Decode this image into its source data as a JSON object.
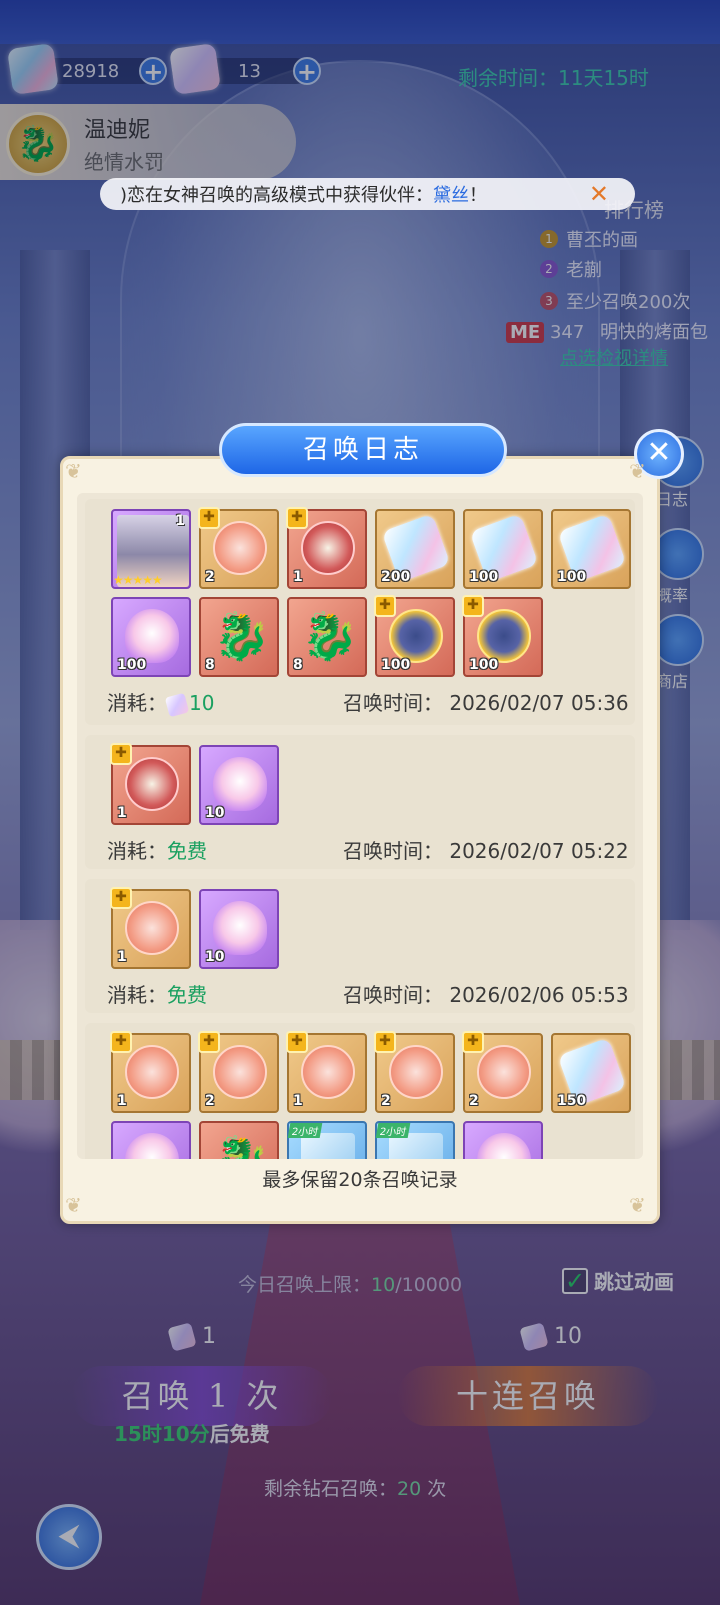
{
  "currency": {
    "diamonds": "28918",
    "tickets": "13",
    "time_left": "剩余时间：11天15时"
  },
  "character": {
    "name": "温迪妮",
    "subtitle": "绝情水罚"
  },
  "marquee": {
    "prefix": ")恋在女神召唤的高级模式中获得伙伴：",
    "partner": "黛丝",
    "suffix": "！"
  },
  "ranking": {
    "title": "排行榜",
    "entries": [
      {
        "rank": "1",
        "name": "曹丕的画"
      },
      {
        "rank": "2",
        "name": "老蒯"
      },
      {
        "rank": "3",
        "name": "至少召唤200次"
      }
    ],
    "me_label": "ME",
    "me_rank": "347",
    "me_name": "明快的烤面包",
    "detail_link": "点选检视详情"
  },
  "side_buttons": {
    "log": "日志",
    "rate": "概率",
    "shop": "商店"
  },
  "modal": {
    "title": "召唤日志",
    "footer": "最多保留20条召唤记录",
    "cost_label": "消耗：",
    "time_label": "召唤时间：",
    "records": [
      {
        "cost": "10",
        "time": "2026/02/07 05:36",
        "items": [
          {
            "kind": "portrait",
            "bg": "purple",
            "qty": "1",
            "stars": "★★★★★"
          },
          {
            "kind": "coin-pink",
            "bg": "orange",
            "qty": "2",
            "shard": true
          },
          {
            "kind": "coin-teal",
            "bg": "red",
            "qty": "1",
            "shard": true
          },
          {
            "kind": "gem",
            "bg": "orange",
            "qty": "200"
          },
          {
            "kind": "gem",
            "bg": "orange",
            "qty": "100"
          },
          {
            "kind": "gem",
            "bg": "orange",
            "qty": "100"
          },
          {
            "kind": "heart",
            "bg": "purple",
            "qty": "100"
          },
          {
            "kind": "dragon",
            "bg": "red",
            "qty": "8"
          },
          {
            "kind": "dragon",
            "bg": "red",
            "qty": "8"
          },
          {
            "kind": "coin-gold",
            "bg": "red",
            "qty": "100",
            "shard": true
          },
          {
            "kind": "coin-gold",
            "bg": "red",
            "qty": "100",
            "shard": true
          }
        ]
      },
      {
        "cost": "免费",
        "time": "2026/02/07 05:22",
        "items": [
          {
            "kind": "coin-teal",
            "bg": "red",
            "qty": "1",
            "shard": true
          },
          {
            "kind": "heart",
            "bg": "purple",
            "qty": "10"
          }
        ]
      },
      {
        "cost": "免费",
        "time": "2026/02/06 05:53",
        "items": [
          {
            "kind": "coin-pink",
            "bg": "orange",
            "qty": "1",
            "shard": true
          },
          {
            "kind": "heart",
            "bg": "purple",
            "qty": "10"
          }
        ]
      },
      {
        "cost": "",
        "time": "",
        "items": [
          {
            "kind": "coin-pink",
            "bg": "orange",
            "qty": "1",
            "shard": true
          },
          {
            "kind": "coin-pink",
            "bg": "orange",
            "qty": "2",
            "shard": true
          },
          {
            "kind": "coin-pink",
            "bg": "orange",
            "qty": "1",
            "shard": true
          },
          {
            "kind": "coin-pink",
            "bg": "orange",
            "qty": "2",
            "shard": true
          },
          {
            "kind": "coin-pink",
            "bg": "orange",
            "qty": "2",
            "shard": true
          },
          {
            "kind": "gem",
            "bg": "orange",
            "qty": "150"
          },
          {
            "kind": "heart",
            "bg": "purple",
            "qty": ""
          },
          {
            "kind": "dragon",
            "bg": "red",
            "qty": ""
          },
          {
            "kind": "card",
            "bg": "blue",
            "qty": "",
            "tag": "2小时"
          },
          {
            "kind": "card",
            "bg": "blue",
            "qty": "",
            "tag": "2小时"
          },
          {
            "kind": "heart",
            "bg": "purple",
            "qty": ""
          }
        ]
      }
    ]
  },
  "bottom": {
    "limit_label": "今日召唤上限：",
    "limit_used": "10",
    "limit_total": "/10000",
    "skip_label": "跳过动画",
    "cost_one": "1",
    "cost_ten": "10",
    "summon_one": "召唤 1 次",
    "summon_ten": "十连召唤",
    "free_timer": "15时10分",
    "free_suffix": "后免费",
    "remain_label": "剩余钻石召唤：",
    "remain_count": "20",
    "remain_unit": " 次"
  }
}
